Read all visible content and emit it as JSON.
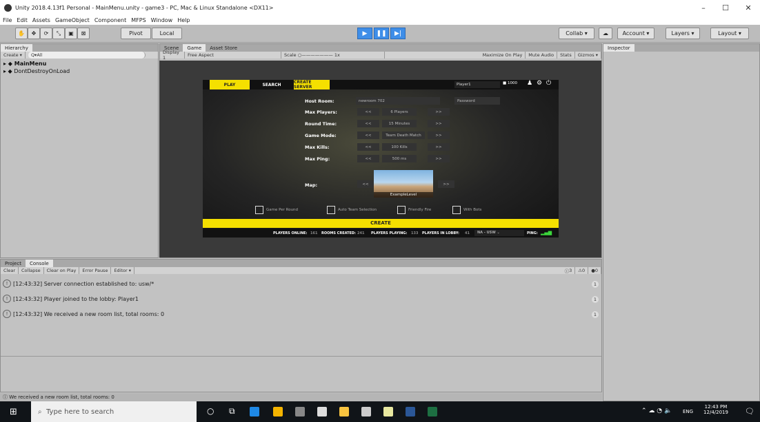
{
  "window": {
    "title": "Unity 2018.4.13f1 Personal - MainMenu.unity - game3 - PC, Mac & Linux Standalone <DX11>",
    "minimize": "–",
    "maximize": "☐",
    "close": "✕"
  },
  "menubar": [
    "File",
    "Edit",
    "Assets",
    "GameObject",
    "Component",
    "MFPS",
    "Window",
    "Help"
  ],
  "toolbar": {
    "pivot": "Pivot",
    "local": "Local",
    "collab": "Collab ▾",
    "account": "Account ▾",
    "layers": "Layers ▾",
    "layout": "Layout ▾"
  },
  "hierarchy": {
    "tab": "Hierarchy",
    "create": "Create ▾",
    "search_placeholder": "Q▾All",
    "items": [
      "MainMenu",
      "DontDestroyOnLoad"
    ]
  },
  "center_tabs": {
    "scene": "Scene",
    "game": "Game",
    "store": "Asset Store"
  },
  "game_toolbar": {
    "display": "Display 1",
    "aspect": "Free Aspect",
    "scale_label": "Scale",
    "scale_value": "1x",
    "maximize": "Maximize On Play",
    "mute": "Mute Audio",
    "stats": "Stats",
    "gizmos": "Gizmos ▾"
  },
  "inspector": {
    "tab": "Inspector"
  },
  "game_menu": {
    "tabs": [
      "PLAY",
      "SEARCH",
      "CREATE SERVER"
    ],
    "player_name": "Player1",
    "coins": "1000",
    "host_room_label": "Host Room:",
    "host_room_value": "newroom 702",
    "password_placeholder": "Password",
    "rows": [
      {
        "label": "Max Players:",
        "value": "6 Players"
      },
      {
        "label": "Round Time:",
        "value": "15 Minutes"
      },
      {
        "label": "Game Mode:",
        "value": "Team Death Match"
      },
      {
        "label": "Max Kills:",
        "value": "100 Kills"
      },
      {
        "label": "Max Ping:",
        "value": "500 ms"
      }
    ],
    "prev": "<<",
    "next": ">>",
    "map_label": "Map:",
    "map_name": "ExampleLevel",
    "checkboxes": [
      "Game Per Round",
      "Auto Team Selection",
      "Friendly Fire",
      "With Bots"
    ],
    "create_button": "CREATE",
    "status": {
      "players_online_label": "PLAYERS ONLINE:",
      "players_online": "161",
      "rooms_created_label": "ROOMS CREATED:",
      "rooms_created": "241",
      "players_playing_label": "PLAYERS PLAYING:",
      "players_playing": "133",
      "players_lobby_label": "PLAYERS IN LOBBY:",
      "players_lobby": "41",
      "region": "NA - USW",
      "ping_label": "PING:"
    }
  },
  "bottom": {
    "tabs": [
      "Project",
      "Console"
    ],
    "buttons": [
      "Clear",
      "Collapse",
      "Clear on Play",
      "Error Pause",
      "Editor ▾"
    ],
    "counts": [
      "3",
      "0",
      "0"
    ],
    "logs": [
      {
        "text": "[12:43:32] Server connection established to: usw/*",
        "count": "1"
      },
      {
        "text": "[12:43:32] Player joined to the lobby: Player1",
        "count": "1"
      },
      {
        "text": "[12:43:32] We received a new room list, total rooms: 0",
        "count": "1"
      }
    ],
    "status_message": "We received a new room list, total rooms: 0"
  },
  "taskbar": {
    "search_placeholder": "Type here to search",
    "lang": "ENG",
    "time": "12:43 PM",
    "date": "12/4/2019"
  },
  "colors": {
    "accent_yellow": "#f5e000",
    "play_blue": "#3f8ee8",
    "taskbar": "#101418"
  }
}
